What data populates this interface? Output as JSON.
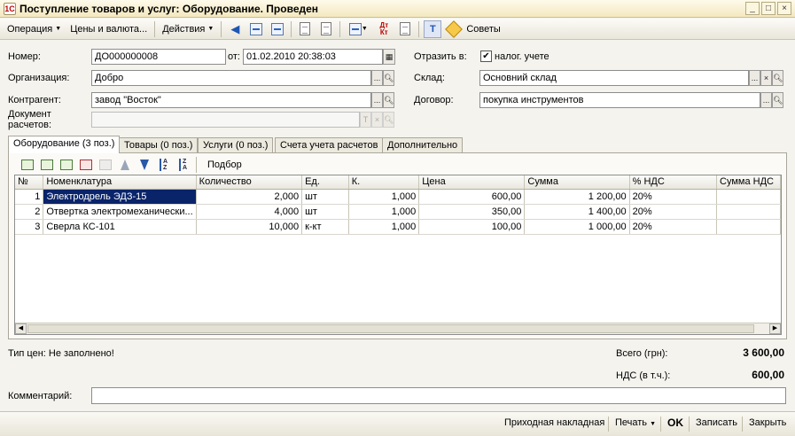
{
  "window": {
    "title": "Поступление товаров и услуг: Оборудование. Проведен",
    "icon_glyph": "1С",
    "controls": [
      "_",
      "□",
      "×"
    ]
  },
  "toolbar": {
    "operation": "Операция",
    "prices_currency": "Цены и валюта...",
    "actions": "Действия",
    "tips": "Советы",
    "dtkt": "Дт Кт"
  },
  "form": {
    "number_label": "Номер:",
    "number_value": "ДО000000008",
    "date_label": "от:",
    "date_value": "01.02.2010 20:38:03",
    "reflect_label": "Отразить в:",
    "tax_check": "✔",
    "tax_label": "налог. учете",
    "org_label": "Организация:",
    "org_value": "Добро",
    "warehouse_label": "Склад:",
    "warehouse_value": "Основний склад",
    "contractor_label": "Контрагент:",
    "contractor_value": "завод \"Восток\"",
    "contract_label": "Договор:",
    "contract_value": "покупка инструментов",
    "settlement_label": "Документ\nрасчетов:",
    "settlement_value": "",
    "btn_dots": "...",
    "btn_x": "×",
    "btn_t": "T"
  },
  "tabs": [
    {
      "label": "Оборудование (3 поз.)",
      "active": true
    },
    {
      "label": "Товары (0 поз.)",
      "active": false
    },
    {
      "label": "Услуги (0 поз.)",
      "active": false
    },
    {
      "label": "Счета учета расчетов",
      "active": false
    },
    {
      "label": "Дополнительно",
      "active": false
    }
  ],
  "subtoolbar": {
    "selection": "Подбор"
  },
  "table": {
    "columns": [
      "№",
      "Номенклатура",
      "Количество",
      "Ед.",
      "К.",
      "Цена",
      "Сумма",
      "% НДС",
      "Сумма НДС"
    ],
    "rows": [
      [
        "1",
        "Электродрель ЭДЗ-15",
        "2,000",
        "шт",
        "1,000",
        "600,00",
        "1 200,00",
        "20%",
        ""
      ],
      [
        "2",
        "Отвертка электромеханически...",
        "4,000",
        "шт",
        "1,000",
        "350,00",
        "1 400,00",
        "20%",
        ""
      ],
      [
        "3",
        "Сверла КС-101",
        "10,000",
        "к-кт",
        "1,000",
        "100,00",
        "1 000,00",
        "20%",
        ""
      ]
    ]
  },
  "footer": {
    "price_type": "Тип цен: Не заполнено!",
    "total_label": "Всего (грн):",
    "total_value": "3 600,00",
    "vat_label": "НДС (в т.ч.):",
    "vat_value": "600,00",
    "comment_label": "Комментарий:",
    "comment_value": ""
  },
  "bottom": {
    "invoice": "Приходная накладная",
    "print": "Печать",
    "ok": "OK",
    "save": "Записать",
    "close": "Закрыть"
  }
}
